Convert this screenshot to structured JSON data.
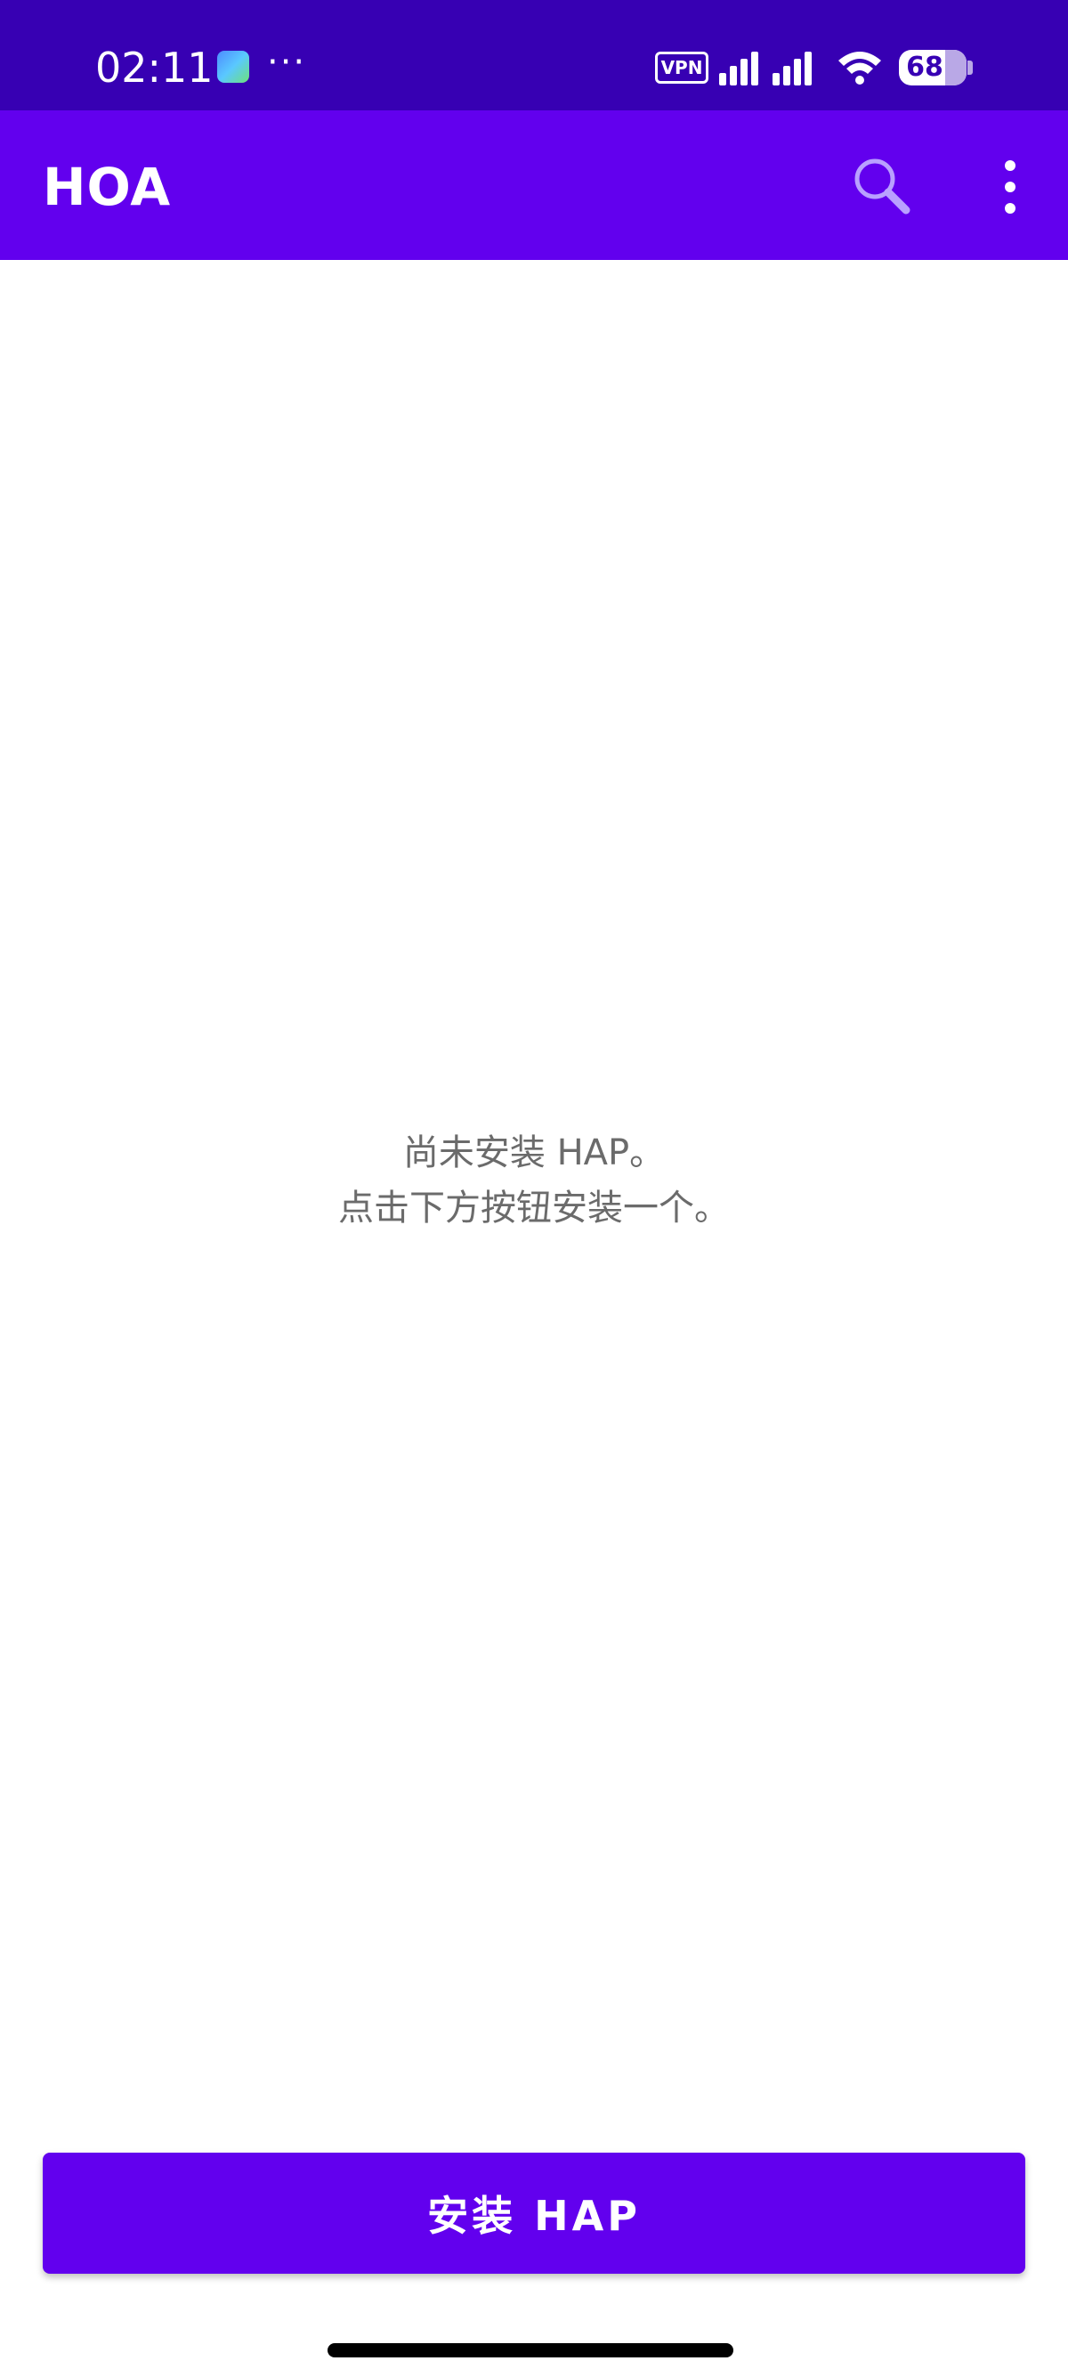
{
  "status_bar": {
    "time": "02:11",
    "notification_icon": "gallery-app-icon",
    "overflow_indicator": "···",
    "vpn_label": "VPN",
    "battery_level": "68",
    "battery_fraction": 0.68
  },
  "app_bar": {
    "title": "HOA",
    "search_icon": "search-icon",
    "menu_icon": "more-vert-icon"
  },
  "empty_state": {
    "line1": "尚未安装 HAP。",
    "line2": "点击下方按钮安装一个。"
  },
  "install_button": {
    "label": "安装 HAP"
  },
  "colors": {
    "status_bar": "#3700b3",
    "primary": "#6200ee",
    "text_secondary": "#6b6b6b"
  }
}
